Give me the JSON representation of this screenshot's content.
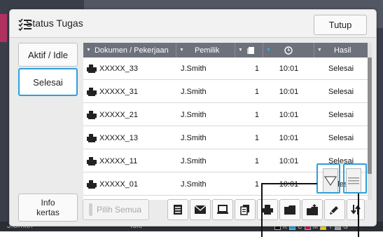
{
  "background": {
    "user_label": "J.Smith",
    "status_label": "Idle",
    "ink_labels": [
      "K",
      "C",
      "M",
      "Y",
      "G"
    ],
    "ink_colors": [
      "#111111",
      "#2e9fd9",
      "#c2185b",
      "#f5d20a",
      "#9e9e9e"
    ]
  },
  "dialog": {
    "title": "Status Tugas",
    "close_label": "Tutup"
  },
  "side_tabs": {
    "active_idle": "Aktif / Idle",
    "done": "Selesai",
    "info_line1": "Info",
    "info_line2": "kertas"
  },
  "table": {
    "columns": [
      "Dokumen / Pekerjaan",
      "Pemilik",
      "",
      "",
      "Hasil"
    ],
    "column_icons": [
      "",
      "",
      "copies-icon",
      "clock-icon",
      ""
    ],
    "sorted_column": "clock",
    "rows": [
      {
        "doc": "XXXXX_33",
        "owner": "J.Smith",
        "copies": "1",
        "time": "10:01",
        "result": "Selesai"
      },
      {
        "doc": "XXXXX_31",
        "owner": "J.Smith",
        "copies": "1",
        "time": "10:01",
        "result": "Selesai"
      },
      {
        "doc": "XXXXX_21",
        "owner": "J.Smith",
        "copies": "1",
        "time": "10:01",
        "result": "Selesai"
      },
      {
        "doc": "XXXXX_13",
        "owner": "J.Smith",
        "copies": "1",
        "time": "10:01",
        "result": "Selesai"
      },
      {
        "doc": "XXXXX_11",
        "owner": "J.Smith",
        "copies": "1",
        "time": "10:01",
        "result": "Selesai"
      },
      {
        "doc": "XXXXX_01",
        "owner": "J.Smith",
        "copies": "1",
        "time": "10:01",
        "result": "Selesai"
      }
    ]
  },
  "toolbar": {
    "select_all": "Pilih Semua",
    "icons": [
      "document-detail-icon",
      "mail-icon",
      "computer-icon",
      "copy-stack-icon",
      "printer-icon",
      "folder-icon",
      "folder-upload-icon",
      "edit-icon",
      "transfer-icon"
    ]
  },
  "overlays": {
    "filter_icon": "filter-icon",
    "list_icon": "list-lines-icon"
  }
}
